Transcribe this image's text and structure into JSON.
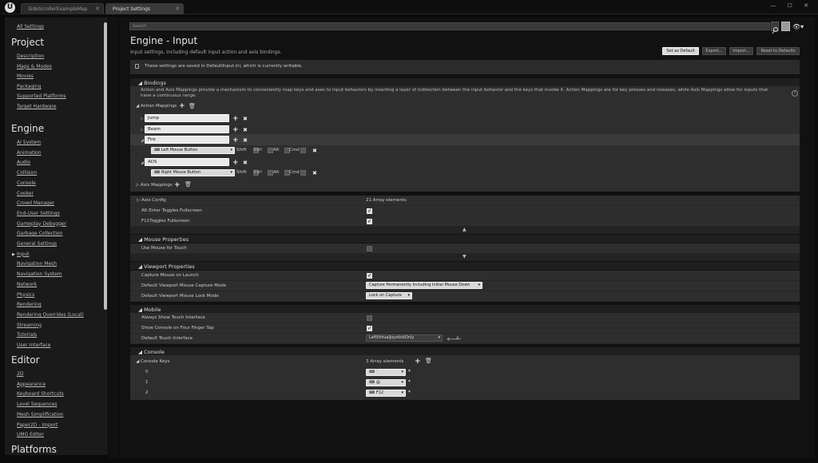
{
  "tabs": [
    {
      "label": "SideScrollerExampleMap"
    },
    {
      "label": "Project Settings"
    }
  ],
  "logo": "U",
  "window_buttons": "— ☐ ✕",
  "sidebar": {
    "all_settings": "All Settings",
    "project": {
      "title": "Project",
      "items": [
        "Description",
        "Maps & Modes",
        "Movies",
        "Packaging",
        "Supported Platforms",
        "Target Hardware"
      ]
    },
    "engine": {
      "title": "Engine",
      "items": [
        "AI System",
        "Animation",
        "Audio",
        "Collision",
        "Console",
        "Cooker",
        "Crowd Manager",
        "End-User Settings",
        "Gameplay Debugger",
        "Garbage Collection",
        "General Settings",
        "Input",
        "Navigation Mesh",
        "Navigation System",
        "Network",
        "Physics",
        "Rendering",
        "Rendering Overrides (Local)",
        "Streaming",
        "Tutorials",
        "User Interface"
      ]
    },
    "editor": {
      "title": "Editor",
      "items": [
        "2D",
        "Appearance",
        "Keyboard Shortcuts",
        "Level Sequences",
        "Mesh Simplification",
        "Paper2D - Import",
        "UMG Editor"
      ]
    },
    "platforms": {
      "title": "Platforms"
    },
    "selected": "Input"
  },
  "search": {
    "placeholder": "Search"
  },
  "header": {
    "title": "Engine - Input",
    "subtitle": "Input settings, including default input action and axis bindings."
  },
  "buttons": {
    "set_default": "Set as Default",
    "export": "Export...",
    "import": "Import...",
    "reset": "Reset to Defaults"
  },
  "notice": "These settings are saved in DefaultInput.ini, which is currently writable.",
  "bindings": {
    "title": "Bindings",
    "description": "Action and Axis Mappings provide a mechanism to conveniently map keys and axes to input behaviors by inserting a layer of indirection between the input behavior and the keys that invoke it. Action Mappings are for key presses and releases, while Axis Mappings allow for inputs that have a continuous range.",
    "action_mappings_label": "Action Mappings",
    "actions": [
      {
        "name": "Jump"
      },
      {
        "name": "Beam"
      },
      {
        "name": "Fire",
        "key": "Left Mouse Button"
      },
      {
        "name": "ADS",
        "key": "Right Mouse Button"
      }
    ],
    "modifiers": [
      "Shift",
      "Ctrl",
      "Alt",
      "Cmd"
    ],
    "axis_mappings_label": "Axis Mappings",
    "axis_config_label": "Axis Config",
    "axis_config_value": "21 Array elements",
    "alt_enter_label": "Alt Enter Toggles Fullscreen",
    "f11_label": "F11Toggles Fullscreen"
  },
  "mouse": {
    "title": "Mouse Properties",
    "use_mouse_for_touch": "Use Mouse for Touch"
  },
  "viewport": {
    "title": "Viewport Properties",
    "capture_on_launch": "Capture Mouse on Launch",
    "capture_mode_label": "Default Viewport Mouse Capture Mode",
    "capture_mode_value": "Capture Permanently Including Initial Mouse Down",
    "lock_mode_label": "Default Viewport Mouse Lock Mode",
    "lock_mode_value": "Lock on Capture"
  },
  "mobile": {
    "title": "Mobile",
    "always_touch": "Always Show Touch Interface",
    "show_console": "Show Console on Four Finger Tap",
    "default_touch_label": "Default Touch Interface",
    "default_touch_value": "LeftVirtualJoystickOnly"
  },
  "console": {
    "title": "Console",
    "keys_label": "Console Keys",
    "keys_value": "3 Array elements",
    "items": [
      {
        "index": "0",
        "value": "`"
      },
      {
        "index": "1",
        "value": "@"
      },
      {
        "index": "2",
        "value": "F12"
      }
    ]
  }
}
